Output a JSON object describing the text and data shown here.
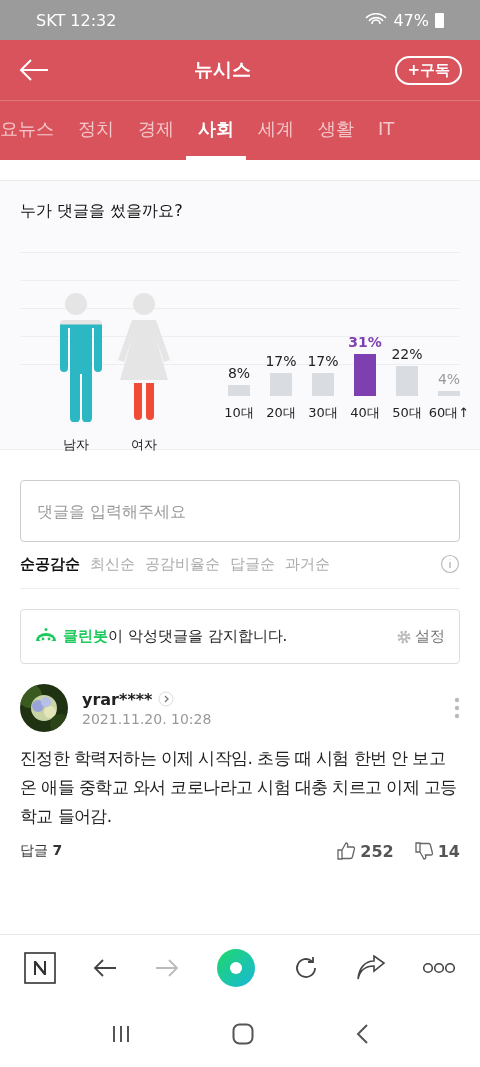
{
  "status_bar": {
    "carrier": "SKT",
    "time": "12:32",
    "battery": "47%"
  },
  "header": {
    "title": "뉴시스",
    "subscribe": "+구독"
  },
  "tabs": [
    {
      "label": "요뉴스",
      "selected": false
    },
    {
      "label": "정치",
      "selected": false
    },
    {
      "label": "경제",
      "selected": false
    },
    {
      "label": "사회",
      "selected": true
    },
    {
      "label": "세계",
      "selected": false
    },
    {
      "label": "생활",
      "selected": false
    },
    {
      "label": "IT",
      "selected": false
    }
  ],
  "stats": {
    "title": "누가 댓글을 썼을까요?",
    "genders": [
      {
        "label": "남자",
        "kind": "male",
        "color": "#2bb8c4"
      },
      {
        "label": "여자",
        "kind": "female",
        "color": "#ef4b36"
      }
    ],
    "chart_data": {
      "type": "bar",
      "categories": [
        "10대",
        "20대",
        "30대",
        "40대",
        "50대",
        "60대↑"
      ],
      "series": [
        {
          "color": "#d9dce0",
          "values": [
            8,
            17,
            17,
            null,
            22,
            4
          ],
          "value_labels": [
            "8%",
            "17%",
            "17%",
            null,
            "22%",
            "4%"
          ]
        },
        {
          "color": "#7e3fb0",
          "values": [
            null,
            null,
            null,
            31,
            null,
            null
          ],
          "value_labels": [
            null,
            null,
            null,
            "31%",
            null,
            null
          ]
        }
      ]
    }
  },
  "comment_input": {
    "placeholder": "댓글을 입력해주세요"
  },
  "sort_options": [
    {
      "label": "순공감순",
      "selected": true
    },
    {
      "label": "최신순",
      "selected": false
    },
    {
      "label": "공감비율순",
      "selected": false
    },
    {
      "label": "답글순",
      "selected": false
    },
    {
      "label": "과거순",
      "selected": false
    }
  ],
  "cleanbot": {
    "name": "클린봇",
    "text": "이 악성댓글을 감지합니다.",
    "settings": "설정"
  },
  "comments": [
    {
      "user": "yrar****",
      "date": "2021.11.20. 10:28",
      "text": "진정한 학력저하는 이제 시작임. 초등 때 시험 한번 안 보고 온 애들 중학교 와서 코로나라고 시험 대충 치르고 이제 고등학교 들어감.",
      "replies_label": "답글",
      "replies": "7",
      "likes": "252",
      "dislikes": "14"
    }
  ]
}
